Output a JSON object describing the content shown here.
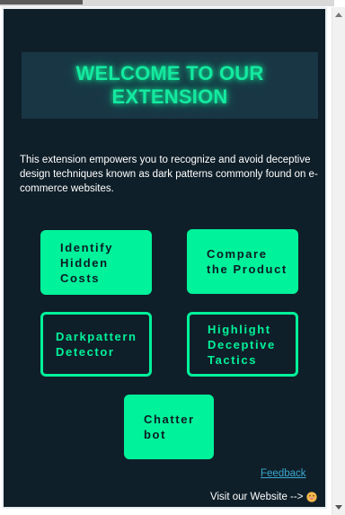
{
  "banner": {
    "title": "WELCOME TO OUR EXTENSION"
  },
  "description": "This extension empowers you to recognize and avoid deceptive design techniques known as dark patterns commonly found on e-commerce websites.",
  "buttons": {
    "hidden_costs": "Identify Hidden Costs",
    "compare": "Compare the Product",
    "detector": "Darkpattern Detector",
    "highlight": "Highlight Deceptive Tactics",
    "chatter": "Chatter bot"
  },
  "footer": {
    "feedback": "Feedback",
    "website": "Visit our Website -->",
    "emoji_icon": "grinning-face-icon"
  },
  "colors": {
    "background": "#0f1f29",
    "accent": "#00f29a",
    "banner_bg": "#193645",
    "link": "#3aa8cf"
  }
}
